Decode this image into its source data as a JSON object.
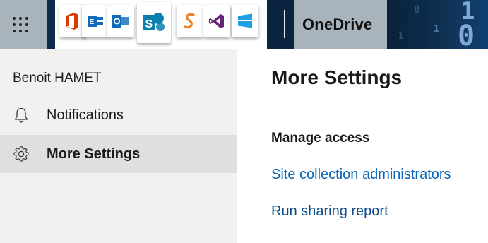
{
  "suite_bar": {
    "app_name": "OneDrive",
    "app_tiles": [
      {
        "icon": "office-icon",
        "color": "#d83b01"
      },
      {
        "icon": "exchange-icon",
        "color": "#0f6cbd"
      },
      {
        "icon": "outlook-icon",
        "color": "#0f6cbd"
      },
      {
        "icon": "sharepoint-icon",
        "color": "#0a7fb0"
      },
      {
        "icon": "sway-icon",
        "color": "#e9822c"
      },
      {
        "icon": "visual-studio-icon",
        "color": "#68217a"
      },
      {
        "icon": "windows-icon",
        "color": "#1fa0e2"
      }
    ],
    "background_glyphs": [
      "1",
      "0",
      "1",
      "0",
      "1"
    ]
  },
  "sidebar": {
    "user_name": "Benoit HAMET",
    "items": [
      {
        "label": "Notifications",
        "icon": "bell-icon"
      },
      {
        "label": "More Settings",
        "icon": "gear-icon",
        "selected": true
      }
    ]
  },
  "main": {
    "title": "More Settings",
    "section_heading": "Manage access",
    "links": [
      {
        "label": "Site collection administrators"
      },
      {
        "label": "Run sharing report"
      }
    ]
  },
  "colors": {
    "suite_bar_bg": "#0d2a4a",
    "waffle_bg": "#a9b3bb",
    "sidebar_bg": "#f2f1f0",
    "selected_bg": "#e0dfde",
    "link": "#0a64b5"
  }
}
